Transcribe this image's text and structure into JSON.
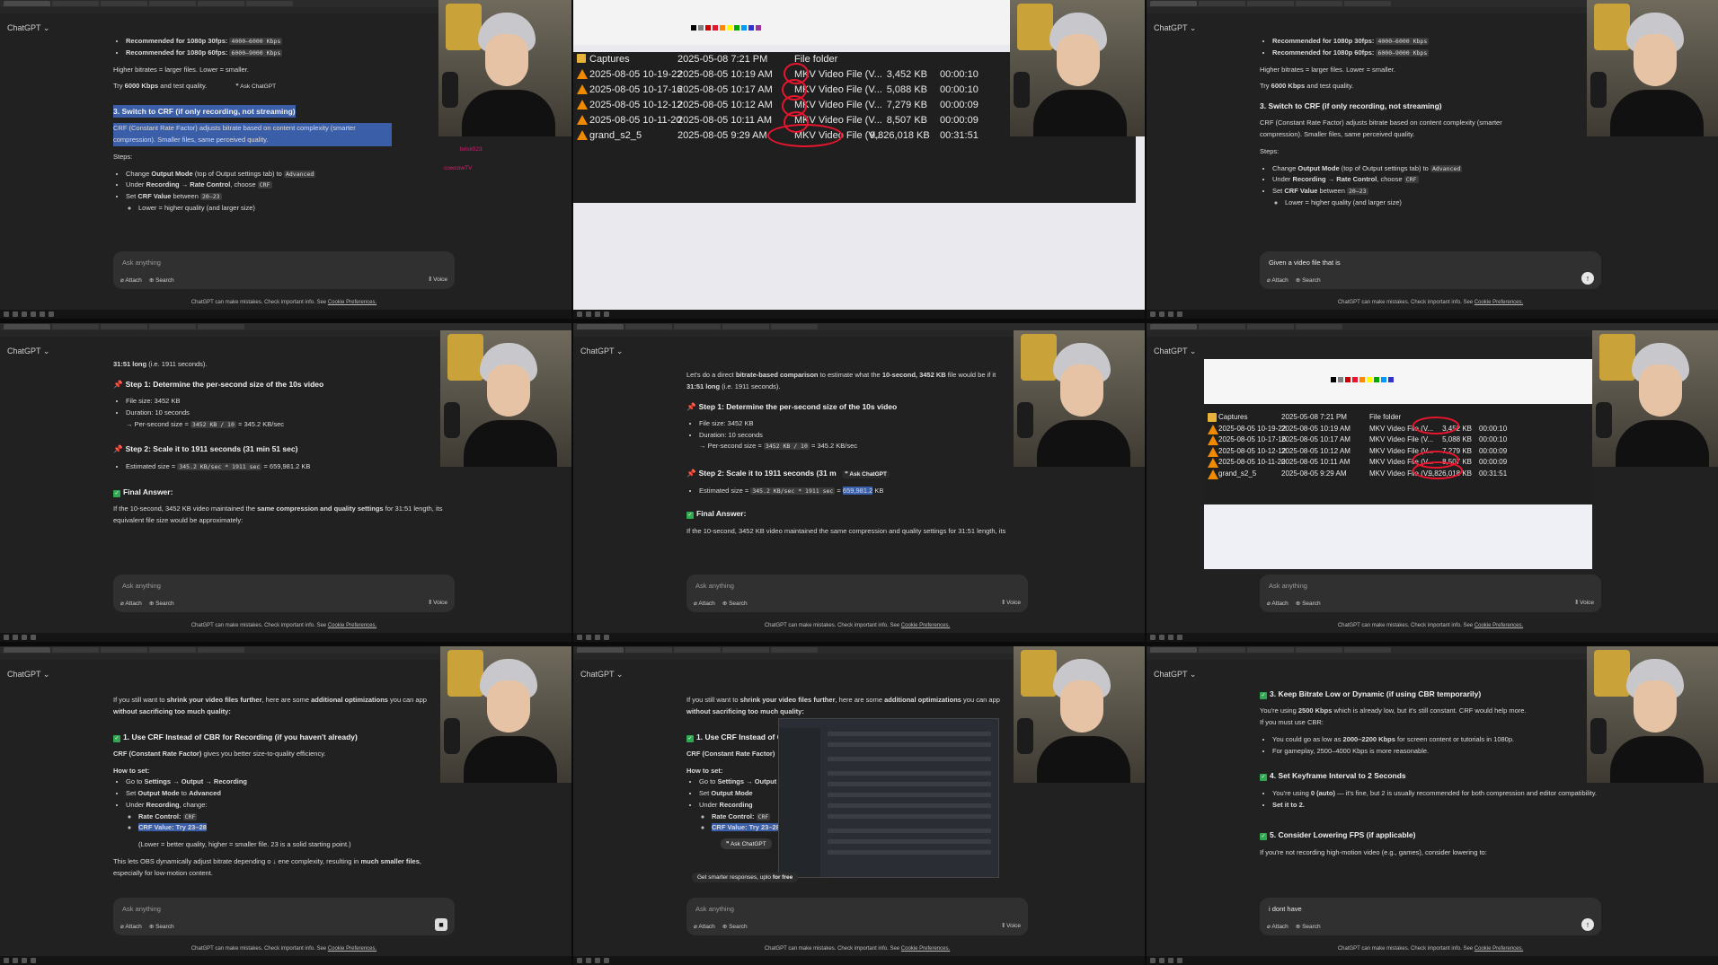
{
  "app": {
    "title": "ChatGPT"
  },
  "composer": {
    "placeholder": "Ask anything",
    "attach": "Attach",
    "search": "Search",
    "voice": "Voice",
    "disclaimer": "ChatGPT can make mistakes. Check important info. See",
    "disclaimer_link": "Cookie Preferences."
  },
  "panel1": {
    "b1": "Recommended for 1080p 30fps:",
    "b1_code": "4000–6000 Kbps",
    "b2": "Recommended for 1080p 60fps:",
    "b2_code": "6000–9000 Kbps",
    "p1": "Higher bitrates = larger files. Lower = smaller.",
    "p2_pre": "Try",
    "p2_bold": "6000 Kbps",
    "p2_post": "and test quality.",
    "ask": "❞ Ask ChatGPT",
    "h": "3. Switch to CRF (if only recording, not streaming)",
    "desc": "CRF (Constant Rate Factor) adjusts bitrate based on content complexity (smarter compression). Smaller files, same perceived quality.",
    "steps": "Steps:",
    "s1_pre": "Change",
    "s1_bold": "Output Mode",
    "s1_mid": "(top of Output settings tab) to",
    "s1_code": "Advanced",
    "s2_pre": "Under",
    "s2_bold": "Recording → Rate Control",
    "s2_mid": ", choose",
    "s2_code": "CRF",
    "s3_pre": "Set",
    "s3_bold": "CRF Value",
    "s3_mid": "between",
    "s3_code": "20–23",
    "s4": "Lower = higher quality (and larger size)",
    "chat1_user": "brisk023",
    "chat2_user": "cowcowTV"
  },
  "explorer": {
    "rows": [
      {
        "name": "Captures",
        "date": "2025-05-08 7:21 PM",
        "type": "File folder",
        "size": "",
        "dur": ""
      },
      {
        "name": "2025-08-05 10-19-22",
        "date": "2025-08-05 10:19 AM",
        "type": "MKV Video File (V...",
        "size": "3,452 KB",
        "dur": "00:00:10"
      },
      {
        "name": "2025-08-05 10-17-16",
        "date": "2025-08-05 10:17 AM",
        "type": "MKV Video File (V...",
        "size": "5,088 KB",
        "dur": "00:00:10"
      },
      {
        "name": "2025-08-05 10-12-12",
        "date": "2025-08-05 10:12 AM",
        "type": "MKV Video File (V...",
        "size": "7,279 KB",
        "dur": "00:00:09"
      },
      {
        "name": "2025-08-05 10-11-20",
        "date": "2025-08-05 10:11 AM",
        "type": "MKV Video File (V...",
        "size": "8,507 KB",
        "dur": "00:00:09"
      },
      {
        "name": "grand_s2_5",
        "date": "2025-08-05 9:29 AM",
        "type": "MKV Video File (V...",
        "size": "9,826,018 KB",
        "dur": "00:31:51"
      }
    ]
  },
  "panel3": {
    "h": "3. Switch to CRF (if only recording, not streaming)",
    "input": "Given a video file that is"
  },
  "panel4": {
    "p0_bold": "31:51 long",
    "p0_post": "(i.e. 1911 seconds).",
    "st1": "Step 1: Determine the per-second size of the 10s video",
    "fs": "File size: 3452 KB",
    "dur": "Duration: 10 seconds",
    "per_pre": "→ Per-second size =",
    "per_code": "3452 KB / 10",
    "per_post": "= 345.2 KB/sec",
    "st2": "Step 2: Scale it to 1911 seconds (31 min 51 sec)",
    "est_pre": "Estimated size =",
    "est_code": "345.2 KB/sec * 1911 sec",
    "est_post": "= 659,981.2 KB",
    "final": "Final Answer:",
    "fa_pre": "If the 10-second, 3452 KB video maintained the",
    "fa_bold": "same compression and quality settings",
    "fa_post": "for 31:51 length, its equivalent file size would be approximately:"
  },
  "panel5": {
    "intro_pre": "Let's do a direct",
    "intro_bold": "bitrate-based comparison",
    "intro_mid": "to estimate what the",
    "intro_bold2": "10-second, 3452 KB",
    "intro_post": "file would be if it",
    "intro2_bold": "31:51 long",
    "intro2_post": "(i.e. 1911 seconds).",
    "st2": "Step 2: Scale it to 1911 seconds (31 m",
    "est_hl": "659,981.2",
    "est_unit": "KB",
    "ask": "❞ Ask ChatGPT",
    "fa_line": "If the 10-second, 3452 KB video maintained the same compression and quality settings for 31:51 length, its"
  },
  "panel7": {
    "intro_pre": "If you still want to",
    "intro_bold": "shrink your video files further",
    "intro_mid": ", here are some",
    "intro_bold2": "additional optimizations",
    "intro_post": "you can app",
    "intro2": "without sacrificing too much quality:",
    "h1": "1. Use CRF Instead of CBR for Recording (if you haven't already)",
    "crf_bold": "CRF (Constant Rate Factor)",
    "crf_post": "gives you better size-to-quality efficiency.",
    "howto": "How to set:",
    "go_pre": "Go to",
    "go_bold": "Settings → Output → Recording",
    "set_pre": "Set",
    "set_bold": "Output Mode",
    "set_mid": "to",
    "set_bold2": "Advanced",
    "under_pre": "Under",
    "under_bold": "Recording",
    "under_post": ", change:",
    "rc_bold": "Rate Control:",
    "rc_code": "CRF",
    "cv": "CRF Value: Try 23–28",
    "lower": "(Lower = better quality, higher = smaller file. 23 is a solid starting point.)",
    "lets_pre": "This lets OBS dynamically adjust bitrate depending o",
    "lets_mid": "ene complexity, resulting in",
    "lets_bold": "much smaller files",
    "lets_post": ",",
    "esp": "especially for low-motion content."
  },
  "panel8": {
    "tooltip": "Get smarter responses, uplo",
    "tooltip_post": "for free"
  },
  "panel9": {
    "h3": "3. Keep Bitrate Low or Dynamic (if using CBR temporarily)",
    "p3_pre": "You're using",
    "p3_bold": "2500 Kbps",
    "p3_post": "which is already low, but it's still constant. CRF would help more.",
    "cbr": "If you must use CBR:",
    "b1_pre": "You could go as low as",
    "b1_bold": "2000–2200 Kbps",
    "b1_post": "for screen content or tutorials in 1080p.",
    "b2": "For gameplay, 2500–4000 Kbps is more reasonable.",
    "h4": "4. Set Keyframe Interval to 2 Seconds",
    "k1_pre": "You're using",
    "k1_bold": "0 (auto)",
    "k1_post": "— it's fine, but 2 is usually recommended for both compression and editor compatibility.",
    "k2_pre": "Set it to",
    "k2_bold": "2",
    "h5": "5. Consider Lowering FPS (if applicable)",
    "p5": "If you're not recording high-motion video (e.g., games), consider lowering to:",
    "input": "i dont have"
  },
  "colors": {
    "highlight": "#3b5ea8",
    "annotation": "#e8152e",
    "check": "#2fa84f"
  }
}
